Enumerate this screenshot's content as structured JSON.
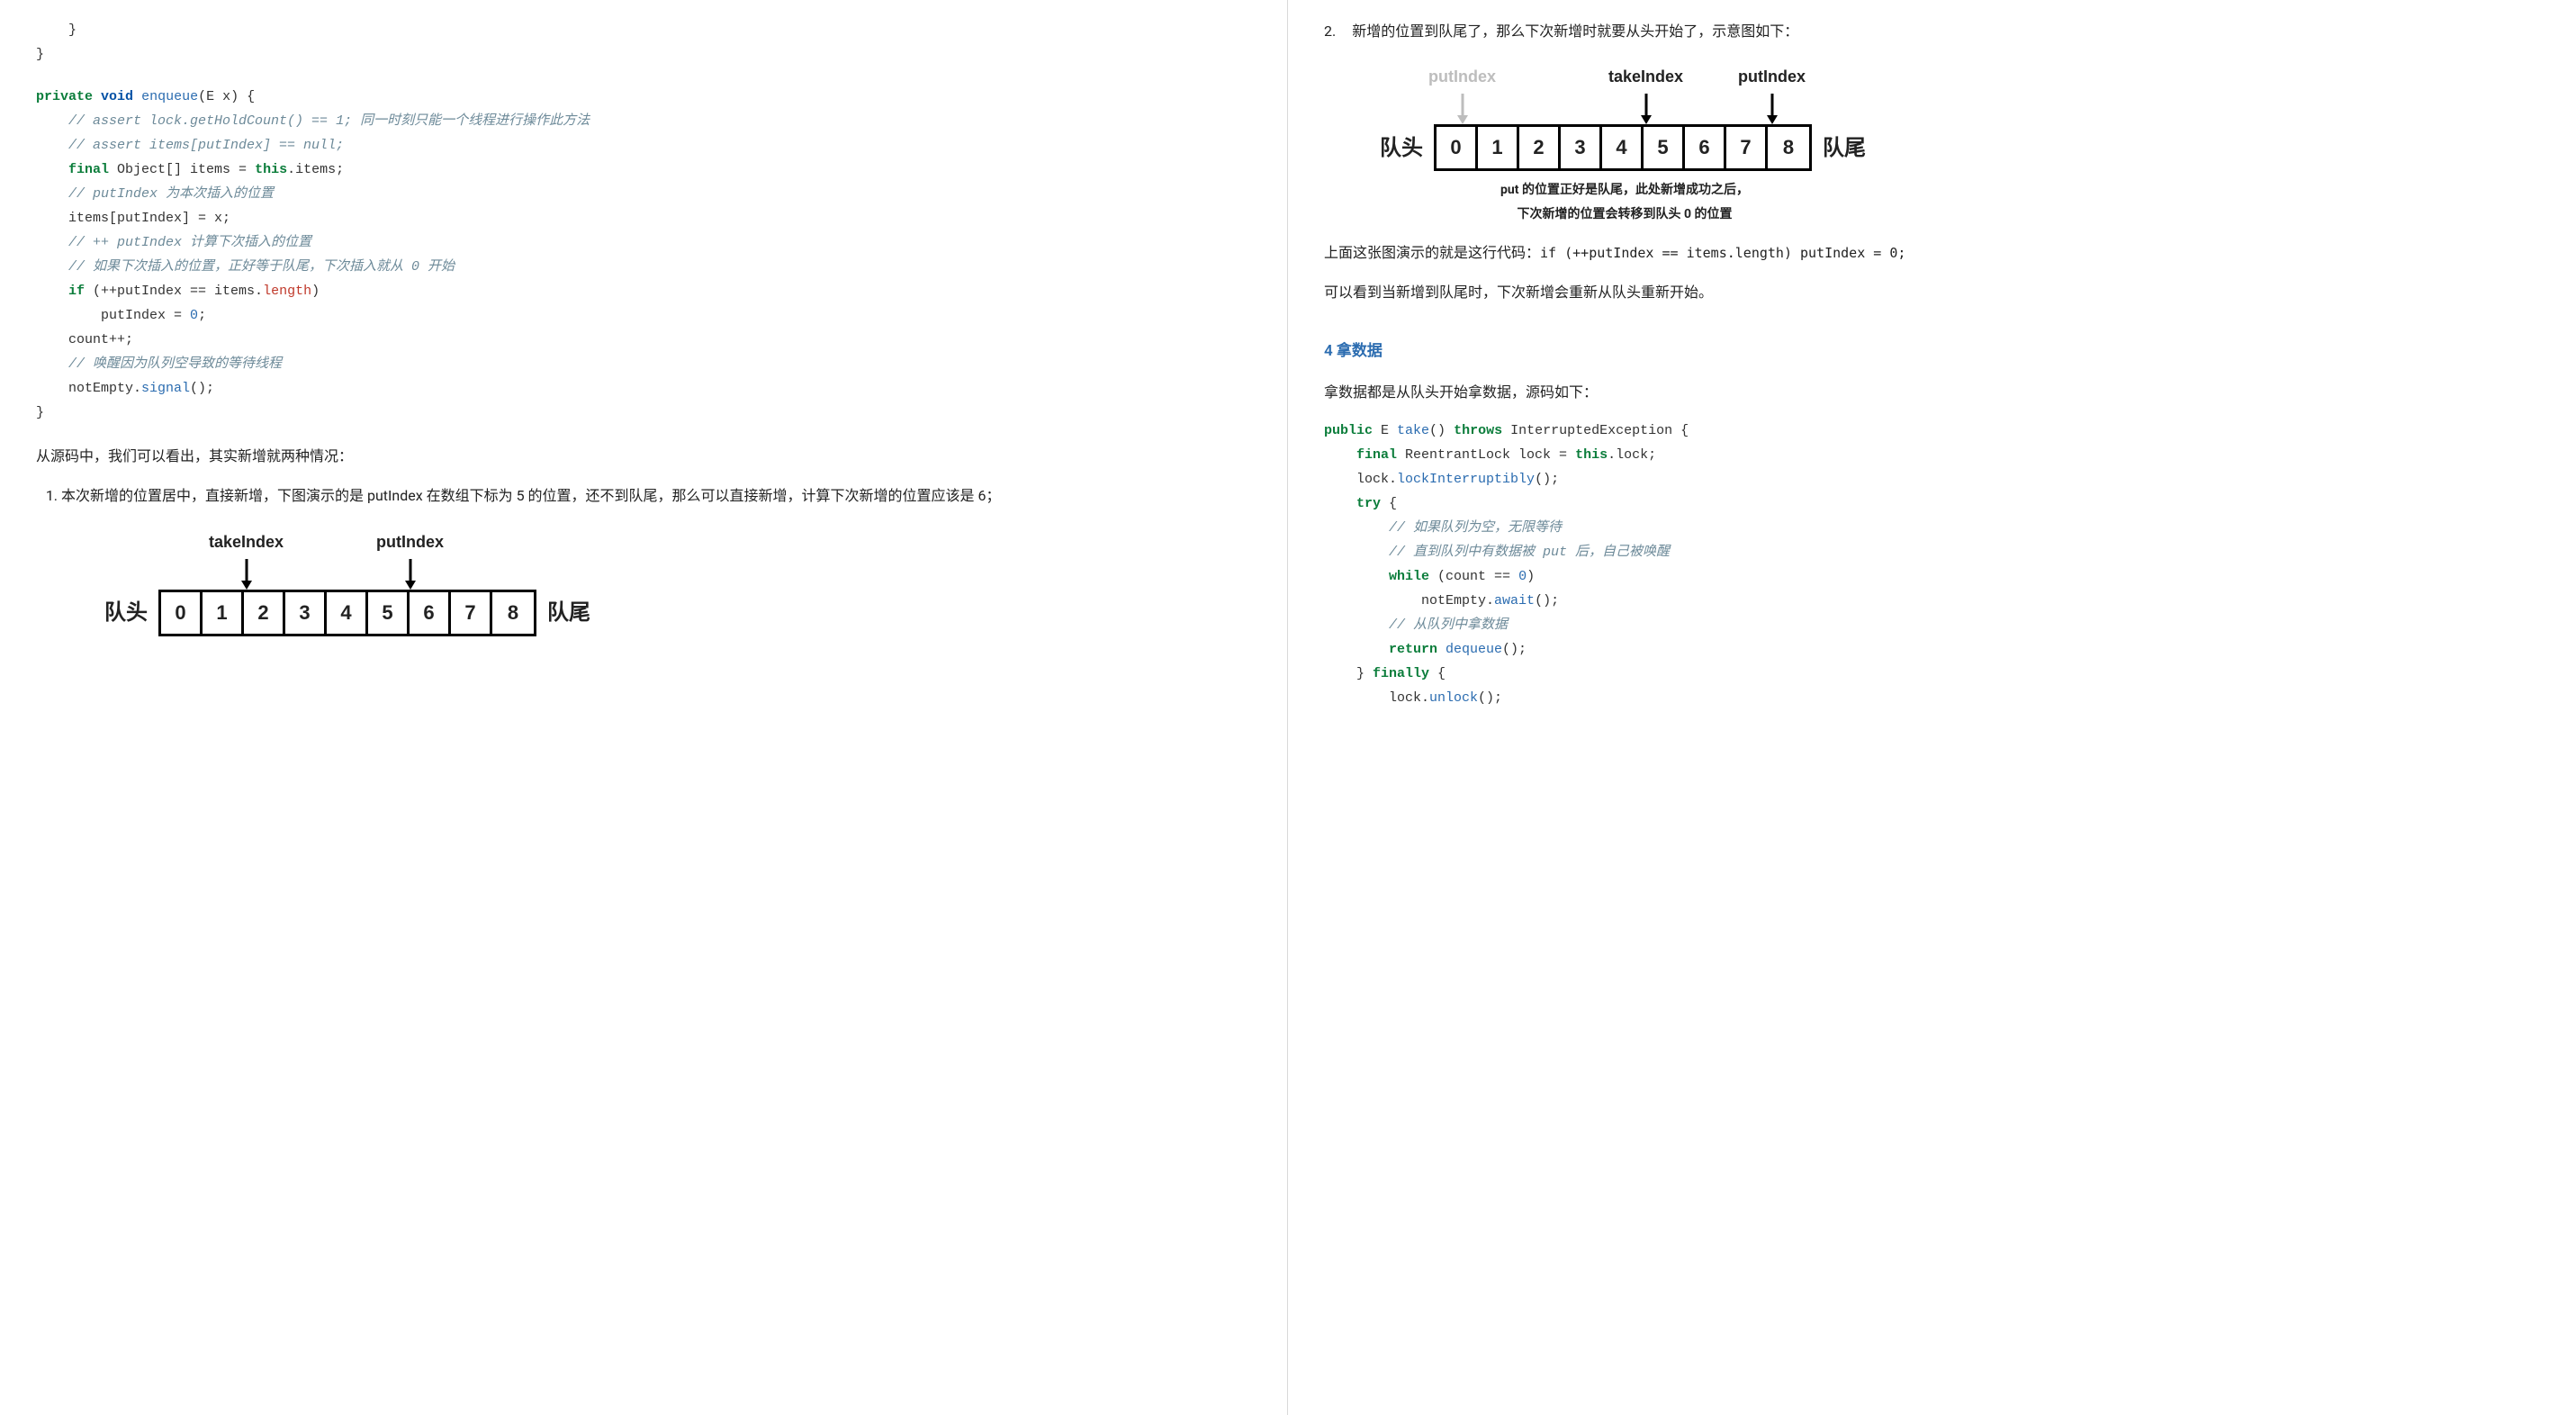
{
  "left": {
    "code_pre": "    }\n}",
    "enqueue": {
      "sig_private": "private",
      "sig_void": "void",
      "sig_name": "enqueue",
      "sig_params": "(E x) {",
      "c1": "// assert lock.getHoldCount() == 1; 同一时刻只能一个线程进行操作此方法",
      "c2": "// assert items[putIndex] == null;",
      "l_final": "final",
      "l_final_rest": " Object[] items = ",
      "l_this": "this",
      "l_final_end": ".items;",
      "c3": "// putIndex 为本次插入的位置",
      "l_assign": "items[putIndex] = x;",
      "c4": "// ++ putIndex 计算下次插入的位置",
      "c5": "// 如果下次插入的位置，正好等于队尾，下次插入就从 0 开始",
      "l_if": "if",
      "l_if_cond": " (++putIndex == items.",
      "l_len": "length",
      "l_if_end": ")",
      "l_put0_a": "putIndex = ",
      "l_put0_num": "0",
      "l_put0_end": ";",
      "l_count": "count++;",
      "c6": "// 唤醒因为队列空导致的等待线程",
      "l_signal_a": "notEmpty.",
      "l_signal_fn": "signal",
      "l_signal_end": "();",
      "close": "}"
    },
    "para_after_code": "从源码中，我们可以看出，其实新增就两种情况：",
    "li1": "本次新增的位置居中，直接新增，下图演示的是 putIndex 在数组下标为 5 的位置，还不到队尾，那么可以直接新增，计算下次新增的位置应该是 6；",
    "diagram1": {
      "take_label": "takeIndex",
      "put_label": "putIndex",
      "head": "队头",
      "tail": "队尾",
      "cells": [
        "0",
        "1",
        "2",
        "3",
        "4",
        "5",
        "6",
        "7",
        "8"
      ]
    }
  },
  "right": {
    "li2_prefix": "2.",
    "li2": "新增的位置到队尾了，那么下次新增时就要从头开始了，示意图如下：",
    "diagram2": {
      "put_gray_label": "putIndex",
      "take_label": "takeIndex",
      "put_label": "putIndex",
      "head": "队头",
      "tail": "队尾",
      "cells": [
        "0",
        "1",
        "2",
        "3",
        "4",
        "5",
        "6",
        "7",
        "8"
      ],
      "caption_l1": "put 的位置正好是队尾，此处新增成功之后，",
      "caption_l2": "下次新增的位置会转移到队头 0 的位置"
    },
    "para_demo_a": "上面这张图演示的就是这行代码：",
    "para_demo_code": "if (++putIndex == items.length) putIndex = 0;",
    "para_demo_b": "可以看到当新增到队尾时，下次新增会重新从队头重新开始。",
    "section4": "4 拿数据",
    "para_take": "拿数据都是从队头开始拿数据，源码如下：",
    "take_code": {
      "sig_public": "public",
      "sig_ret": " E ",
      "sig_name": "take",
      "sig_paren": "() ",
      "sig_throws": "throws",
      "sig_exc": " InterruptedException {",
      "l_final": "final",
      "l_final_rest": " ReentrantLock lock = ",
      "l_this": "this",
      "l_final_end": ".lock;",
      "l_lock_a": "lock.",
      "l_lock_fn": "lockInterruptibly",
      "l_lock_end": "();",
      "l_try": "try",
      "l_try_end": " {",
      "c1": "// 如果队列为空，无限等待",
      "c2": "// 直到队列中有数据被 put 后，自己被唤醒",
      "l_while": "while",
      "l_while_cond": " (count == ",
      "l_zero": "0",
      "l_while_end": ")",
      "l_await_a": "notEmpty.",
      "l_await_fn": "await",
      "l_await_end": "();",
      "c3": "// 从队列中拿数据",
      "l_return": "return",
      "l_return_fn": " dequeue",
      "l_return_end": "();",
      "l_finally_a": "} ",
      "l_finally": "finally",
      "l_finally_end": " {",
      "l_unlock_a": "lock.",
      "l_unlock_fn": "unlock",
      "l_unlock_end": "();"
    }
  },
  "chart_data": [
    {
      "type": "table",
      "title": "Diagram 1 — enqueue mid-array",
      "indices": [
        0,
        1,
        2,
        3,
        4,
        5,
        6,
        7,
        8
      ],
      "takeIndex": 1,
      "putIndex": 5,
      "head_label": "队头",
      "tail_label": "队尾"
    },
    {
      "type": "table",
      "title": "Diagram 2 — enqueue at tail wraps to head",
      "indices": [
        0,
        1,
        2,
        3,
        4,
        5,
        6,
        7,
        8
      ],
      "takeIndex": 5,
      "putIndex_current": 8,
      "putIndex_next": 0,
      "head_label": "队头",
      "tail_label": "队尾",
      "caption": "put 的位置正好是队尾，此处新增成功之后，下次新增的位置会转移到队头 0 的位置"
    }
  ]
}
